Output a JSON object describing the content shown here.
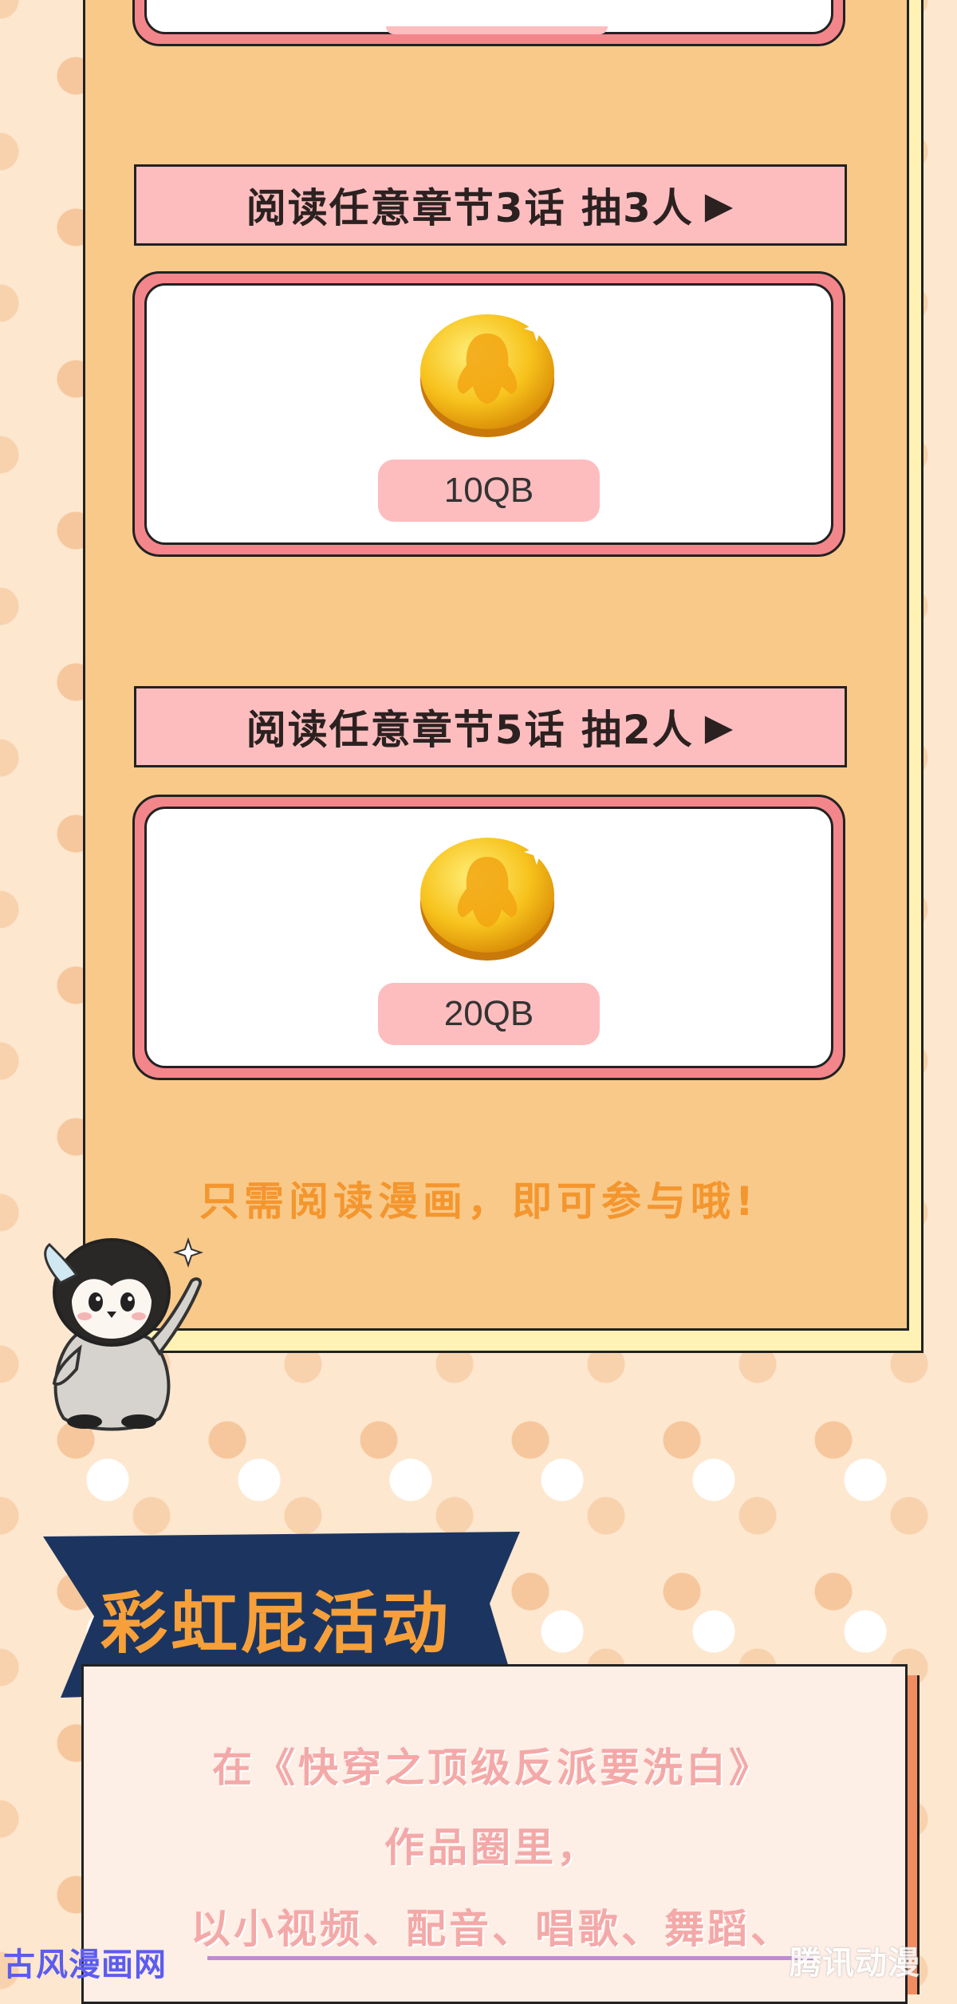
{
  "top_card": {},
  "prize_sections": [
    {
      "banner": "阅读任意章节3话 抽3人",
      "arrow": "▶",
      "prize": "10QB",
      "coin_icon": "qq-coin-icon"
    },
    {
      "banner": "阅读任意章节5话 抽2人",
      "arrow": "▶",
      "prize": "20QB",
      "coin_icon": "qq-coin-icon"
    }
  ],
  "note": "只需阅读漫画，即可参与哦!",
  "rainbow": {
    "title": "彩虹屁活动",
    "lines": [
      "在《快穿之顶级反派要洗白》",
      "作品圈里，",
      "以小视频、配音、唱歌、舞蹈、"
    ]
  },
  "watermarks": {
    "left": "古风漫画网",
    "right": "腾讯动漫"
  },
  "colors": {
    "panel": "#f9c98a",
    "banner": "#fdbdbf",
    "card_border": "#f3868b",
    "note": "#f4962e",
    "title_bg": "#1c3560",
    "title_text": "#f7a03a"
  }
}
